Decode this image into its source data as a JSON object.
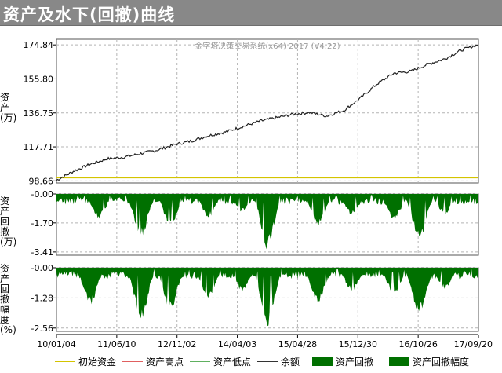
{
  "window_title": "资产及水下(回撤)曲线",
  "chart_data": [
    {
      "type": "line",
      "subtitle": "金字塔决策交易系统(x64) 2017 (V4.22)",
      "ylabel": "资产(万)",
      "yticks": [
        "174.84",
        "155.80",
        "136.75",
        "117.71",
        "98.66"
      ],
      "ylim": [
        97.5,
        178
      ],
      "initial_capital": 100.4,
      "series": [
        {
          "name": "余额",
          "color": "#000000",
          "x": [
            0,
            0.04,
            0.08,
            0.12,
            0.16,
            0.2,
            0.24,
            0.28,
            0.32,
            0.36,
            0.4,
            0.44,
            0.48,
            0.52,
            0.56,
            0.6,
            0.64,
            0.68,
            0.72,
            0.76,
            0.8,
            0.84,
            0.88,
            0.92,
            0.96,
            1.0
          ],
          "y": [
            99,
            104,
            108,
            111,
            112,
            114,
            116,
            119,
            121,
            124,
            126,
            129,
            132,
            134,
            136,
            137,
            135,
            138,
            145,
            153,
            159,
            160,
            164,
            167,
            172,
            175
          ]
        }
      ]
    },
    {
      "type": "area",
      "ylabel": "资产回撤(万)",
      "yticks": [
        "-0.00",
        "-1.70",
        "-3.41"
      ],
      "ylim": [
        -3.6,
        0
      ],
      "series": [
        {
          "name": "资产回撤",
          "color": "#007000"
        }
      ],
      "minima": [
        {
          "x": 0.1,
          "y": -1.5
        },
        {
          "x": 0.2,
          "y": -2.6
        },
        {
          "x": 0.27,
          "y": -1.9
        },
        {
          "x": 0.36,
          "y": -1.4
        },
        {
          "x": 0.44,
          "y": -1.1
        },
        {
          "x": 0.5,
          "y": -3.3
        },
        {
          "x": 0.62,
          "y": -1.9
        },
        {
          "x": 0.7,
          "y": -1.3
        },
        {
          "x": 0.8,
          "y": -1.6
        },
        {
          "x": 0.86,
          "y": -2.9
        },
        {
          "x": 0.92,
          "y": -1.2
        }
      ]
    },
    {
      "type": "area",
      "ylabel": "资产回撤幅度(%)",
      "yticks": [
        "-0.00",
        "-1.28",
        "-2.56"
      ],
      "ylim": [
        -2.7,
        0
      ],
      "series": [
        {
          "name": "资产回撤幅度",
          "color": "#007000"
        }
      ],
      "minima": [
        {
          "x": 0.08,
          "y": -1.6
        },
        {
          "x": 0.2,
          "y": -2.3
        },
        {
          "x": 0.27,
          "y": -1.8
        },
        {
          "x": 0.36,
          "y": -1.3
        },
        {
          "x": 0.44,
          "y": -1.0
        },
        {
          "x": 0.5,
          "y": -2.5
        },
        {
          "x": 0.62,
          "y": -1.5
        },
        {
          "x": 0.7,
          "y": -1.0
        },
        {
          "x": 0.8,
          "y": -1.2
        },
        {
          "x": 0.86,
          "y": -2.0
        },
        {
          "x": 0.92,
          "y": -0.9
        }
      ]
    }
  ],
  "xticks": [
    "10/01/04",
    "11/06/10",
    "12/11/02",
    "14/04/03",
    "15/04/28",
    "15/12/30",
    "16/10/26",
    "17/09/20"
  ],
  "legend": [
    {
      "label": "初始资金",
      "color": "#d4c400",
      "kind": "line"
    },
    {
      "label": "资产高点",
      "color": "#e06060",
      "kind": "line"
    },
    {
      "label": "资产低点",
      "color": "#60b060",
      "kind": "line"
    },
    {
      "label": "余额",
      "color": "#333333",
      "kind": "line"
    },
    {
      "label": "资产回撤",
      "color": "#007000",
      "kind": "box"
    },
    {
      "label": "资产回撤幅度",
      "color": "#007000",
      "kind": "box"
    }
  ]
}
